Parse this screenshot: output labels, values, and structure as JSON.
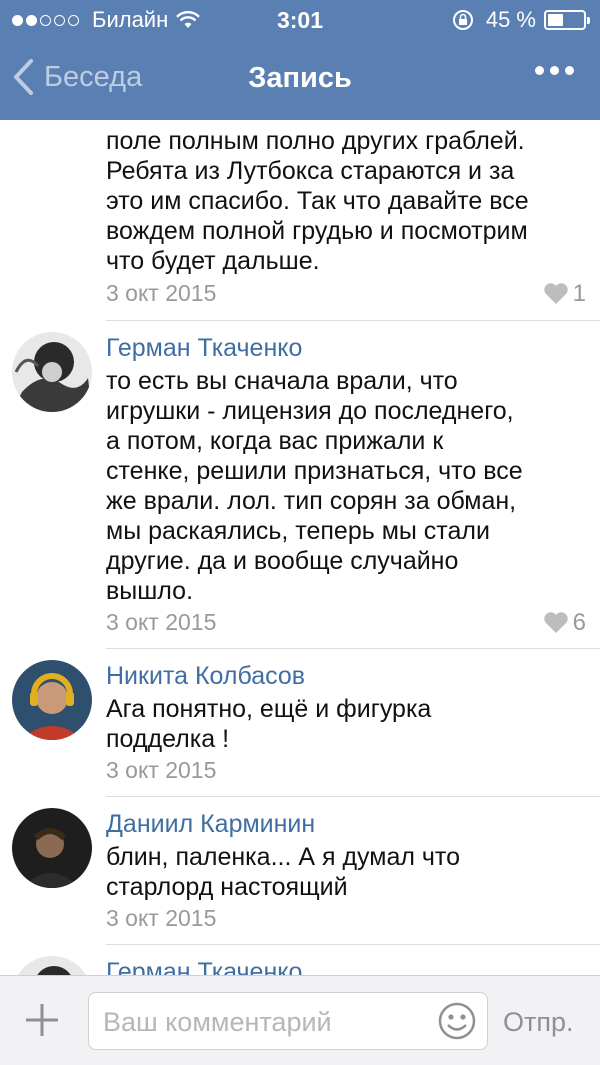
{
  "status_bar": {
    "carrier": "Билайн",
    "time": "3:01",
    "battery_percent": "45 %",
    "battery_level": 0.45
  },
  "nav": {
    "back_label": "Беседа",
    "title": "Запись"
  },
  "comments": [
    {
      "author": "",
      "text": "поле полным полно других граблей.\nРебята из Лутбокса стараются и за\nэто им спасибо. Так что давайте все\nвождем полной грудью и посмотрим\nчто будет дальше.",
      "date": "3 окт 2015",
      "likes": "1"
    },
    {
      "author": "Герман Ткаченко",
      "text": "то есть вы сначала врали, что\nигрушки - лицензия до последнего,\nа потом, когда вас прижали к\nстенке, решили признаться, что все\nже врали. лол. тип сорян за обман,\nмы раскаялись, теперь мы стали\nдругие. да и вообще случайно\nвышло.",
      "date": "3 окт 2015",
      "likes": "6"
    },
    {
      "author": "Никита Колбасов",
      "text": "Ага понятно, ещё и фигурка\nподделка !",
      "date": "3 окт 2015"
    },
    {
      "author": "Даниил Карминин",
      "text": "блин, паленка... А я думал что\nстарлорд настоящий",
      "date": "3 окт 2015"
    },
    {
      "author": "Герман Ткаченко"
    }
  ],
  "composer": {
    "placeholder": "Ваш комментарий",
    "send_label": "Отпр."
  },
  "colors": {
    "header": "#5a7fb2",
    "author": "#3f6ea3",
    "meta": "#999999"
  }
}
